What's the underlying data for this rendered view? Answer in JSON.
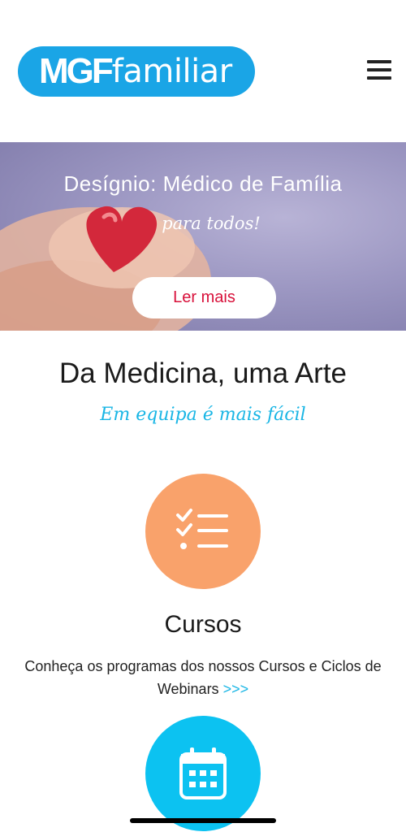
{
  "header": {
    "logo_part1": "MGF",
    "logo_part2": "amiliar",
    "menu_icon": "hamburger-menu-icon"
  },
  "hero": {
    "title": "Desígnio: Médico de Família",
    "subtitle": "para todos!",
    "button_label": "Ler mais",
    "image": "hands-holding-heart"
  },
  "intro": {
    "title": "Da Medicina, uma Arte",
    "subtitle": "Em equipa é mais fácil"
  },
  "sections": [
    {
      "icon": "checklist-icon",
      "title": "Cursos",
      "description": "Conheça os programas dos nossos Cursos e Ciclos de Webinars",
      "link": ">>>"
    },
    {
      "icon": "calendar-icon"
    }
  ],
  "colors": {
    "brand_blue": "#1aa5e6",
    "accent_cyan": "#1ab6e5",
    "orange": "#f9a26b",
    "button_text_red": "#d8103a"
  }
}
